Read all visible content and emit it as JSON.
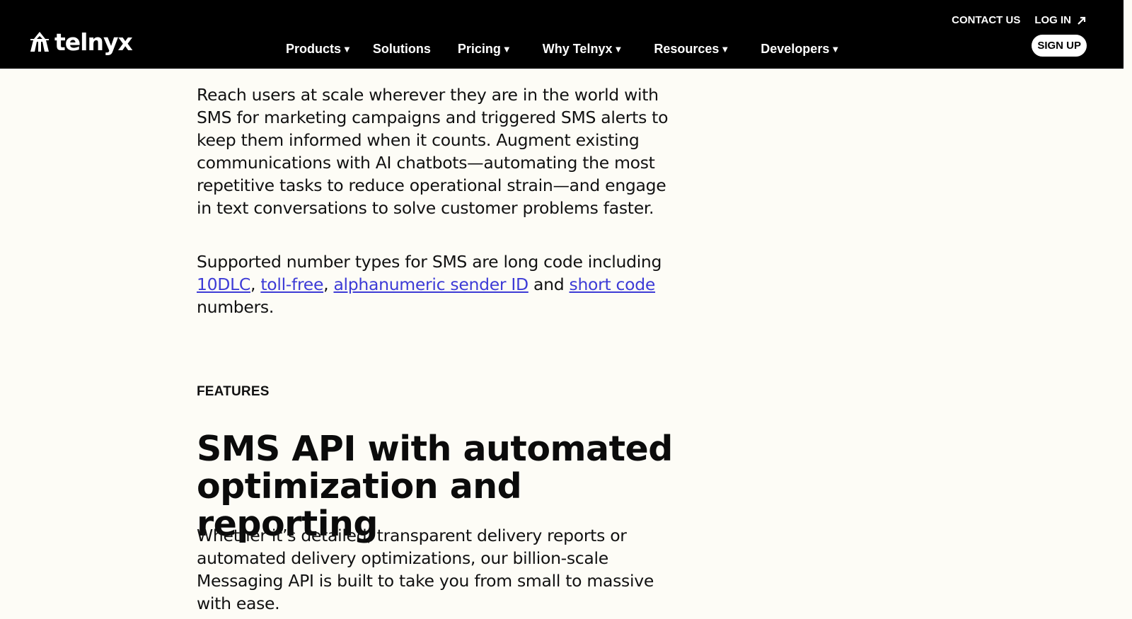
{
  "brand": {
    "name": "telnyx"
  },
  "header": {
    "contact_label": "CONTACT US",
    "login_label": "LOG IN",
    "signup_label": "SIGN UP",
    "nav": [
      {
        "label": "Products",
        "has_caret": true
      },
      {
        "label": "Solutions",
        "has_caret": false
      },
      {
        "label": "Pricing",
        "has_caret": true
      },
      {
        "label": "Why Telnyx",
        "has_caret": true
      },
      {
        "label": "Resources",
        "has_caret": true
      },
      {
        "label": "Developers",
        "has_caret": true
      }
    ],
    "caret_glyph": "▼"
  },
  "content": {
    "intro": "Reach users at scale wherever they are in the world with SMS for marketing campaigns and triggered SMS alerts to keep them informed when it counts. Augment existing communications with AI chatbots—automating the most repetitive tasks to reduce operational strain—and engage in text conversations to solve customer problems faster.",
    "number_types": {
      "prefix": "Supported number types for SMS are long code including ",
      "link_10dlc": "10DLC",
      "sep1": ", ",
      "link_tollfree": "toll-free",
      "sep2": ", ",
      "link_alpha": "alphanumeric sender ID",
      "and": " and ",
      "link_shortcode": "short code",
      "suffix": " numbers."
    },
    "eyebrow": "FEATURES",
    "headline": "SMS API with automated optimization and reporting",
    "description": "Whether it’s detailed, transparent delivery reports or automated delivery optimizations, our billion-scale Messaging API is built to take you from small to massive with ease."
  },
  "colors": {
    "background": "#fdfcf6",
    "header_bg": "#000000",
    "link": "#3d3bd6",
    "text": "#111111"
  }
}
